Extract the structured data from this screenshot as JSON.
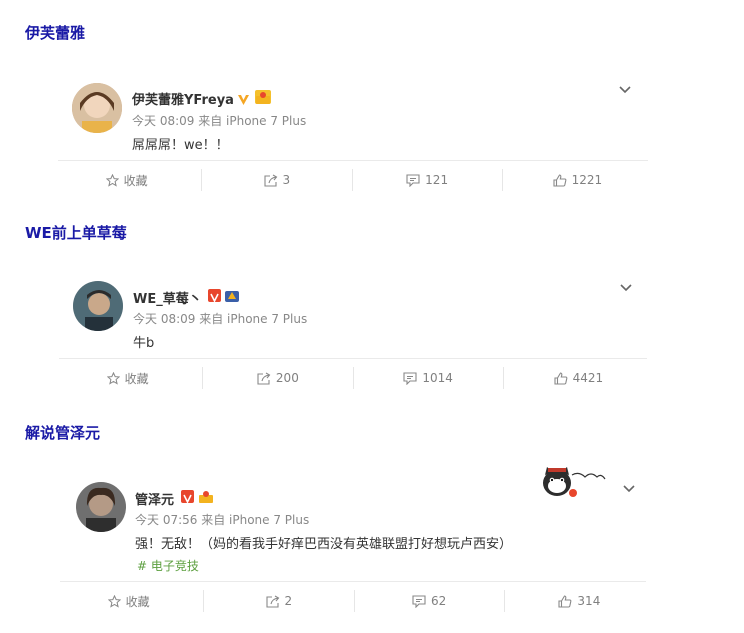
{
  "posts": [
    {
      "section_title": "伊芙蕾雅",
      "username": "伊芙蕾雅YFreya",
      "meta": "今天 08:09 来自 iPhone 7 Plus",
      "content": "屌屌屌！we！！",
      "actions": {
        "collect": "收藏",
        "repost": "3",
        "comment": "121",
        "like": "1221"
      }
    },
    {
      "section_title": "WE前上单草莓",
      "username": "WE_草莓丶",
      "meta": "今天 08:09 来自 iPhone 7 Plus",
      "content": "牛b",
      "actions": {
        "collect": "收藏",
        "repost": "200",
        "comment": "1014",
        "like": "4421"
      }
    },
    {
      "section_title": "解说管泽元",
      "username": "管泽元",
      "meta": "今天 07:56 来自 iPhone 7 Plus",
      "content": "强！无敌！（妈的看我手好痒巴西没有英雄联盟打好想玩卢西安）",
      "tag": "# 电子竞技",
      "actions": {
        "collect": "收藏",
        "repost": "2",
        "comment": "62",
        "like": "314"
      }
    }
  ],
  "colors": {
    "section_title": "#1a1aa6",
    "vip_badge": "#f5a623",
    "verified_badge": "#e8462c",
    "tag": "#5c9f3f"
  },
  "icons": [
    "star-icon",
    "share-icon",
    "comment-icon",
    "thumb-up-icon",
    "chevron-down-icon"
  ]
}
